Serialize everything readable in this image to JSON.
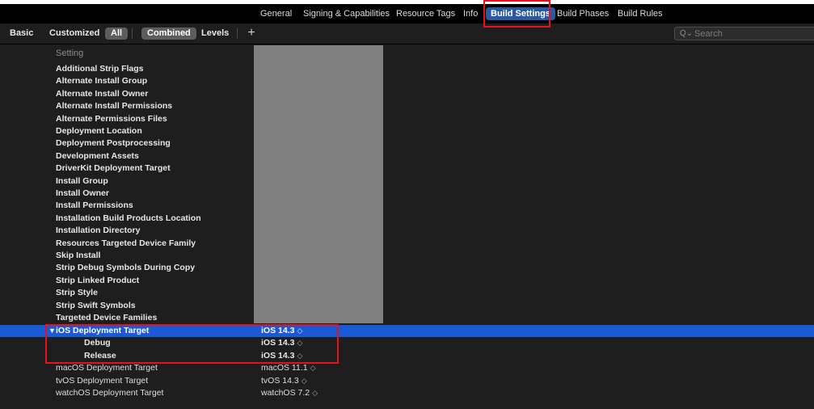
{
  "tabs": [
    {
      "label": "General"
    },
    {
      "label": "Signing & Capabilities"
    },
    {
      "label": "Resource Tags"
    },
    {
      "label": "Info"
    },
    {
      "label": "Build Settings"
    },
    {
      "label": "Build Phases"
    },
    {
      "label": "Build Rules"
    }
  ],
  "filters": {
    "basic": "Basic",
    "customized": "Customized",
    "all": "All",
    "combined": "Combined",
    "levels": "Levels",
    "plus": "+"
  },
  "search": {
    "icon": "Q⌄",
    "placeholder": "Search"
  },
  "table": {
    "column_header": "Setting",
    "rows": [
      {
        "name": "Additional Strip Flags"
      },
      {
        "name": "Alternate Install Group"
      },
      {
        "name": "Alternate Install Owner"
      },
      {
        "name": "Alternate Install Permissions"
      },
      {
        "name": "Alternate Permissions Files"
      },
      {
        "name": "Deployment Location"
      },
      {
        "name": "Deployment Postprocessing"
      },
      {
        "name": "Development Assets"
      },
      {
        "name": "DriverKit Deployment Target"
      },
      {
        "name": "Install Group"
      },
      {
        "name": "Install Owner"
      },
      {
        "name": "Install Permissions"
      },
      {
        "name": "Installation Build Products Location"
      },
      {
        "name": "Installation Directory"
      },
      {
        "name": "Resources Targeted Device Family"
      },
      {
        "name": "Skip Install"
      },
      {
        "name": "Strip Debug Symbols During Copy"
      },
      {
        "name": "Strip Linked Product"
      },
      {
        "name": "Strip Style"
      },
      {
        "name": "Strip Swift Symbols"
      },
      {
        "name": "Targeted Device Families"
      },
      {
        "name": "iOS Deployment Target",
        "value": "iOS 14.3",
        "disclosure": "▼"
      },
      {
        "name": "Debug",
        "value": "iOS 14.3"
      },
      {
        "name": "Release",
        "value": "iOS 14.3"
      },
      {
        "name": "macOS Deployment Target",
        "value": "macOS 11.1"
      },
      {
        "name": "tvOS Deployment Target",
        "value": "tvOS 14.3"
      },
      {
        "name": "watchOS Deployment Target",
        "value": "watchOS 7.2"
      }
    ],
    "stepper_glyph": "◇"
  },
  "colors": {
    "selection": "#1a5ad7",
    "tab_selected": "#2a5aa4",
    "annotation_red": "#e4131b",
    "redacted_gray": "#808080"
  }
}
